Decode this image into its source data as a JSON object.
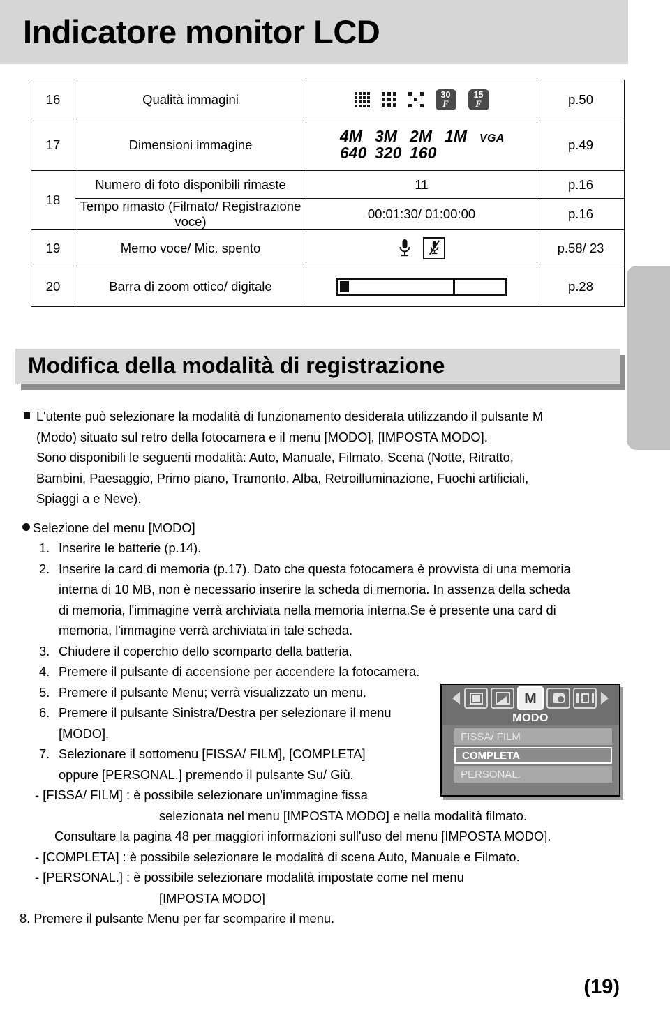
{
  "banner": {
    "title": "Indicatore monitor LCD"
  },
  "table": {
    "rows": [
      {
        "num": "16",
        "desc": "Qualità immagini",
        "icon_type": "quality",
        "quality_badges": [
          "30",
          "15"
        ],
        "page": "p.50"
      },
      {
        "num": "17",
        "desc": "Dimensioni immagine",
        "icon_type": "image-size",
        "sizes_top": [
          "4M",
          "3M",
          "2M",
          "1M",
          "VGA"
        ],
        "sizes_bottom": [
          "640",
          "320",
          "160"
        ],
        "page": "p.49"
      },
      {
        "num": "18",
        "desc_a": "Numero di foto disponibili rimaste",
        "value_a": "11",
        "page_a": "p.16",
        "desc_b": "Tempo rimasto (Filmato/ Registrazione voce)",
        "value_b": "00:01:30/ 01:00:00",
        "page_b": "p.16"
      },
      {
        "num": "19",
        "desc": "Memo voce/ Mic. spento",
        "icon_type": "mic",
        "page": "p.58/ 23"
      },
      {
        "num": "20",
        "desc": "Barra di zoom ottico/ digitale",
        "icon_type": "zoombar",
        "page": "p.28"
      }
    ]
  },
  "section": {
    "heading": "Modifica della modalità di registrazione"
  },
  "body": {
    "intro_lines": [
      "L'utente può selezionare la modalità di funzionamento desiderata utilizzando il pulsante M",
      "(Modo) situato sul retro della fotocamera e il menu [MODO], [IMPOSTA MODO].",
      "Sono disponibili le seguenti modalità: Auto, Manuale, Filmato, Scena (Notte, Ritratto,",
      "Bambini, Paesaggio, Primo piano, Tramonto, Alba, Retroilluminazione, Fuochi artificiali,",
      "Spiaggi a e Neve)."
    ],
    "menu_selection_label": "Selezione del menu [MODO]",
    "steps": [
      {
        "n": "1.",
        "lines": [
          "Inserire le batterie (p.14)."
        ]
      },
      {
        "n": "2.",
        "lines": [
          "Inserire la card di memoria (p.17). Dato che questa fotocamera è provvista di una memoria",
          "interna di 10 MB, non è necessario inserire la scheda di memoria. In assenza della scheda",
          "di memoria, l'immagine verrà archiviata nella memoria interna.Se è presente una card di",
          "memoria, l'immagine verrà archiviata in tale scheda."
        ]
      },
      {
        "n": "3.",
        "lines": [
          "Chiudere il coperchio dello scomparto della batteria."
        ]
      },
      {
        "n": "4.",
        "lines": [
          "Premere il pulsante di accensione per accendere la fotocamera."
        ]
      },
      {
        "n": "5.",
        "lines": [
          "Premere il pulsante Menu; verrà visualizzato un menu."
        ]
      },
      {
        "n": "6.",
        "lines": [
          "Premere il pulsante Sinistra/Destra per selezionare il menu",
          "[MODO]."
        ]
      },
      {
        "n": "7.",
        "lines": [
          "Selezionare il sottomenu [FISSA/ FILM], [COMPLETA]",
          "oppure [PERSONAL.] premendo il pulsante Su/ Giù."
        ]
      }
    ],
    "dash_items": [
      "- [FISSA/ FILM] : è possibile selezionare un'immagine fissa",
      "selezionata nel menu [IMPOSTA MODO] e nella modalità filmato.",
      "Consultare la pagina 48 per maggiori informazioni sull'uso del menu [IMPOSTA MODO].",
      "- [COMPLETA]   : è possibile selezionare le modalità di scena Auto, Manuale e Filmato.",
      "- [PERSONAL.]  : è possibile selezionare modalità impostate come nel menu",
      "[IMPOSTA MODO]"
    ],
    "final_step": "8. Premere il pulsante Menu per far scomparire il menu."
  },
  "lcd": {
    "menu_title": "MODO",
    "tabs": [
      "playback-icon",
      "scene-icon",
      "mode-m-icon",
      "camera-p-icon",
      "display-icon"
    ],
    "active_tab_label": "M",
    "items": [
      {
        "label": "FISSA/ FILM",
        "selected": false
      },
      {
        "label": "COMPLETA",
        "selected": true
      },
      {
        "label": "PERSONAL.",
        "selected": false
      }
    ]
  },
  "footer": {
    "page_number": "(19)"
  }
}
